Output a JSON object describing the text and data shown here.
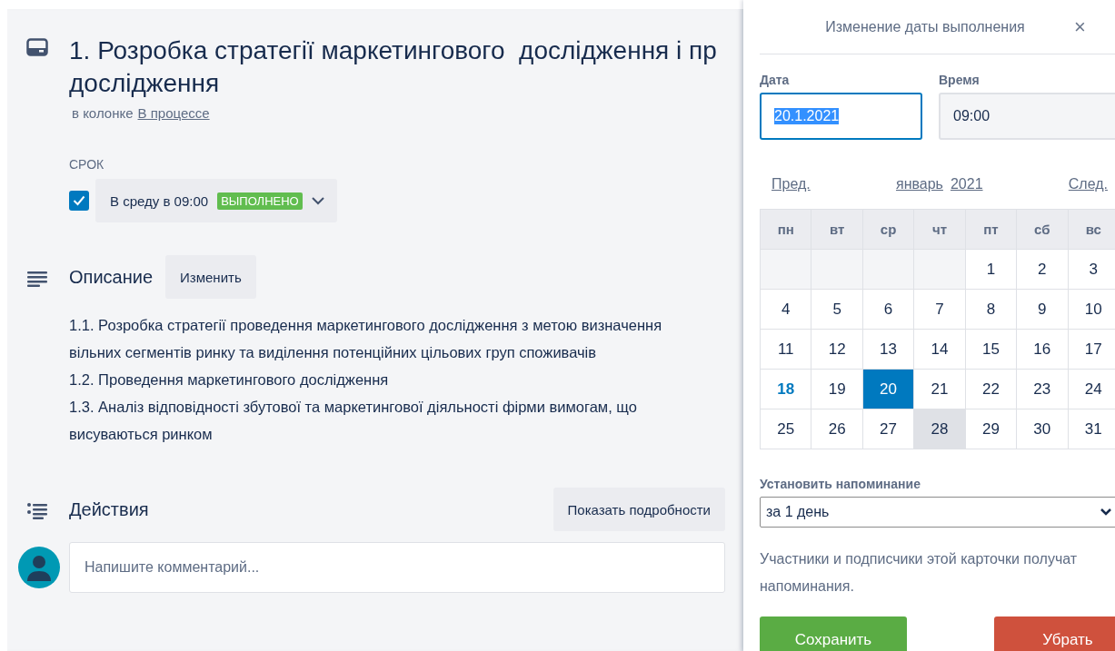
{
  "card": {
    "title_lines": [
      "1. Розробка стратегії маркетингового  дослідження і пр",
      "дослідження"
    ],
    "list_prefix": "в колонке",
    "list_link": "В процессе",
    "due": {
      "label": "СРОК",
      "checked": true,
      "date": "В среду в 09:00",
      "badge": "ВЫПОЛНЕНО"
    },
    "description": {
      "heading": "Описание",
      "edit_button": "Изменить",
      "paragraphs": [
        "1.1. Розробка стратегії проведення маркетингового дослідження з метою визначення вільних сегментів ринку та виділення потенційних цільових груп споживачів",
        "1.2. Проведення маркетингового дослідження",
        "1.3. Аналіз відповідності збутової та маркетингової діяльності фірми вимогам, що висуваються ринком"
      ]
    },
    "activity": {
      "heading": "Действия",
      "details_button": "Показать подробности",
      "comment_placeholder": "Напишите комментарий..."
    }
  },
  "popover": {
    "title": "Изменение даты выполнения",
    "close": "×",
    "date_label": "Дата",
    "date_value": "20.1.2021",
    "time_label": "Время",
    "time_value": "09:00",
    "prev": "Пред.",
    "month": "январь",
    "year": "2021",
    "next": "След.",
    "weekdays": [
      "пн",
      "вт",
      "ср",
      "чт",
      "пт",
      "сб",
      "вс"
    ],
    "weeks": [
      [
        {
          "kind": "blank"
        },
        {
          "kind": "blank"
        },
        {
          "kind": "blank"
        },
        {
          "kind": "blank"
        },
        {
          "kind": "day",
          "day": "1",
          "selected": false,
          "today": false,
          "hovered": false
        },
        {
          "kind": "day",
          "day": "2",
          "selected": false,
          "today": false,
          "hovered": false
        },
        {
          "kind": "day",
          "day": "3",
          "selected": false,
          "today": false,
          "hovered": false
        }
      ],
      [
        {
          "kind": "day",
          "day": "4",
          "selected": false,
          "today": false,
          "hovered": false
        },
        {
          "kind": "day",
          "day": "5",
          "selected": false,
          "today": false,
          "hovered": false
        },
        {
          "kind": "day",
          "day": "6",
          "selected": false,
          "today": false,
          "hovered": false
        },
        {
          "kind": "day",
          "day": "7",
          "selected": false,
          "today": false,
          "hovered": false
        },
        {
          "kind": "day",
          "day": "8",
          "selected": false,
          "today": false,
          "hovered": false
        },
        {
          "kind": "day",
          "day": "9",
          "selected": false,
          "today": false,
          "hovered": false
        },
        {
          "kind": "day",
          "day": "10",
          "selected": false,
          "today": false,
          "hovered": false
        }
      ],
      [
        {
          "kind": "day",
          "day": "11",
          "selected": false,
          "today": false,
          "hovered": false
        },
        {
          "kind": "day",
          "day": "12",
          "selected": false,
          "today": false,
          "hovered": false
        },
        {
          "kind": "day",
          "day": "13",
          "selected": false,
          "today": false,
          "hovered": false
        },
        {
          "kind": "day",
          "day": "14",
          "selected": false,
          "today": false,
          "hovered": false
        },
        {
          "kind": "day",
          "day": "15",
          "selected": false,
          "today": false,
          "hovered": false
        },
        {
          "kind": "day",
          "day": "16",
          "selected": false,
          "today": false,
          "hovered": false
        },
        {
          "kind": "day",
          "day": "17",
          "selected": false,
          "today": false,
          "hovered": false
        }
      ],
      [
        {
          "kind": "day",
          "day": "18",
          "selected": false,
          "today": true,
          "hovered": false
        },
        {
          "kind": "day",
          "day": "19",
          "selected": false,
          "today": false,
          "hovered": false
        },
        {
          "kind": "day",
          "day": "20",
          "selected": true,
          "today": false,
          "hovered": false
        },
        {
          "kind": "day",
          "day": "21",
          "selected": false,
          "today": false,
          "hovered": false
        },
        {
          "kind": "day",
          "day": "22",
          "selected": false,
          "today": false,
          "hovered": false
        },
        {
          "kind": "day",
          "day": "23",
          "selected": false,
          "today": false,
          "hovered": false
        },
        {
          "kind": "day",
          "day": "24",
          "selected": false,
          "today": false,
          "hovered": false
        }
      ],
      [
        {
          "kind": "day",
          "day": "25",
          "selected": false,
          "today": false,
          "hovered": false
        },
        {
          "kind": "day",
          "day": "26",
          "selected": false,
          "today": false,
          "hovered": false
        },
        {
          "kind": "day",
          "day": "27",
          "selected": false,
          "today": false,
          "hovered": false
        },
        {
          "kind": "day",
          "day": "28",
          "selected": false,
          "today": false,
          "hovered": true
        },
        {
          "kind": "day",
          "day": "29",
          "selected": false,
          "today": false,
          "hovered": false
        },
        {
          "kind": "day",
          "day": "30",
          "selected": false,
          "today": false,
          "hovered": false
        },
        {
          "kind": "day",
          "day": "31",
          "selected": false,
          "today": false,
          "hovered": false
        }
      ]
    ],
    "reminder_label": "Установить напоминание",
    "reminder_value": "за 1 день",
    "note": "Участники и подписчики этой карточки получат напоминания.",
    "save_button": "Сохранить",
    "remove_button": "Убрать"
  }
}
